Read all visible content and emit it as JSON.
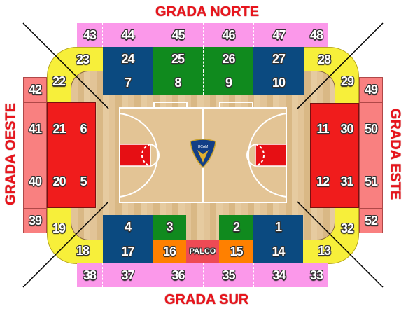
{
  "titles": {
    "north": "GRADA NORTE",
    "south": "GRADA SUR",
    "west": "GRADA OESTE",
    "east": "GRADA ESTE"
  },
  "logo_text": "UCAM",
  "north": {
    "upper": [
      "43",
      "44",
      "45",
      "46",
      "47",
      "48"
    ],
    "mid_top": [
      "24",
      "25",
      "26",
      "27"
    ],
    "mid_bottom": [
      "7",
      "8",
      "9",
      "10"
    ]
  },
  "south": {
    "inner": [
      "4",
      "3",
      "2",
      "1"
    ],
    "middle": [
      "17",
      "16",
      "PALCO",
      "15",
      "14"
    ],
    "upper": [
      "38",
      "37",
      "36",
      "35",
      "34",
      "33"
    ]
  },
  "west": {
    "outer": [
      "42",
      "41",
      "40",
      "39"
    ],
    "middle": [
      "21",
      "20"
    ],
    "inner": [
      "6",
      "5"
    ]
  },
  "east": {
    "inner": [
      "11",
      "12"
    ],
    "middle": [
      "30",
      "31"
    ],
    "outer": [
      "49",
      "50",
      "51",
      "52"
    ]
  },
  "corners": {
    "nw": [
      "23",
      "22"
    ],
    "ne": [
      "28",
      "29"
    ],
    "sw": [
      "19",
      "18"
    ],
    "se": [
      "32",
      "13"
    ]
  },
  "colors": {
    "upper": "#fb98ea",
    "blue": "#0b4a80",
    "green": "#108a1e",
    "red": "#f01c1c",
    "salmon": "#f98080",
    "yellow": "#f7ef3a",
    "orange": "#ff8000",
    "palco": "#ee4a55"
  }
}
